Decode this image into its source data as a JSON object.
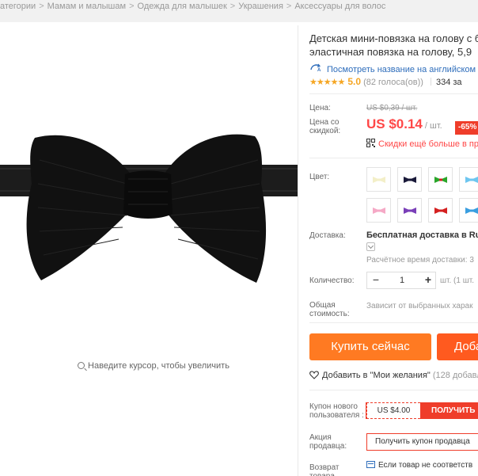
{
  "breadcrumb": {
    "items": [
      "атегории",
      "Мамам и малышам",
      "Одежда для малышек",
      "Украшения",
      "Аксессуары для волос"
    ],
    "separator": ">"
  },
  "image": {
    "zoom_hint": "Наведите курсор, чтобы увеличить",
    "product_color": "#141414"
  },
  "product": {
    "title_line1": "Детская мини-повязка на голову с б",
    "title_line2": "эластичная повязка на голову, 5,9",
    "translate_link": "Посмотреть название на английском",
    "rating_stars": "★★★★★",
    "rating_value": "5.0",
    "votes": "(82 голоса(ов))",
    "orders": "334 за"
  },
  "price": {
    "label_price": "Цена:",
    "label_discount": "Цена со скидкой:",
    "old_price": "US $0,39 / шт.",
    "new_price": "US $0.14",
    "unit": "/ шт.",
    "discount_badge": "-65%",
    "qr_text": "Скидки ещё больше в пр",
    "accent_color": "#ff4747"
  },
  "options": {
    "color_label": "Цвет:",
    "swatch_colors": [
      "#f3efc8",
      "#1a1a3a",
      "#2aa62a",
      "#6ec6f0",
      "#f5a9c6",
      "#7a3fb8",
      "#d42020",
      "#3a9ee0"
    ]
  },
  "shipping": {
    "label": "Доставка:",
    "title": "Бесплатная доставка в Rus",
    "time": "Расчётное время доставки: 3"
  },
  "quantity": {
    "label": "Количество:",
    "minus": "−",
    "value": "1",
    "plus": "+",
    "note": "шт. (1 шт."
  },
  "total": {
    "label": "Общая стоимость:",
    "note": "Зависит от выбранных харак"
  },
  "actions": {
    "buy_now": "Купить сейчас",
    "add_to_cart": "Доба",
    "wishlist": "Добавить в \"Мои желания\"",
    "wishlist_count": "(128 добавле"
  },
  "coupons": {
    "new_user_label": "Купон нового пользователя :",
    "amount": "US $4.00",
    "get_button": "ПОЛУЧИТЬ",
    "promo_label": "Акция продавца:",
    "promo_text": "Получить купон продавца",
    "return_label": "Возврат товара",
    "return_text": "Если товар не соответств"
  }
}
